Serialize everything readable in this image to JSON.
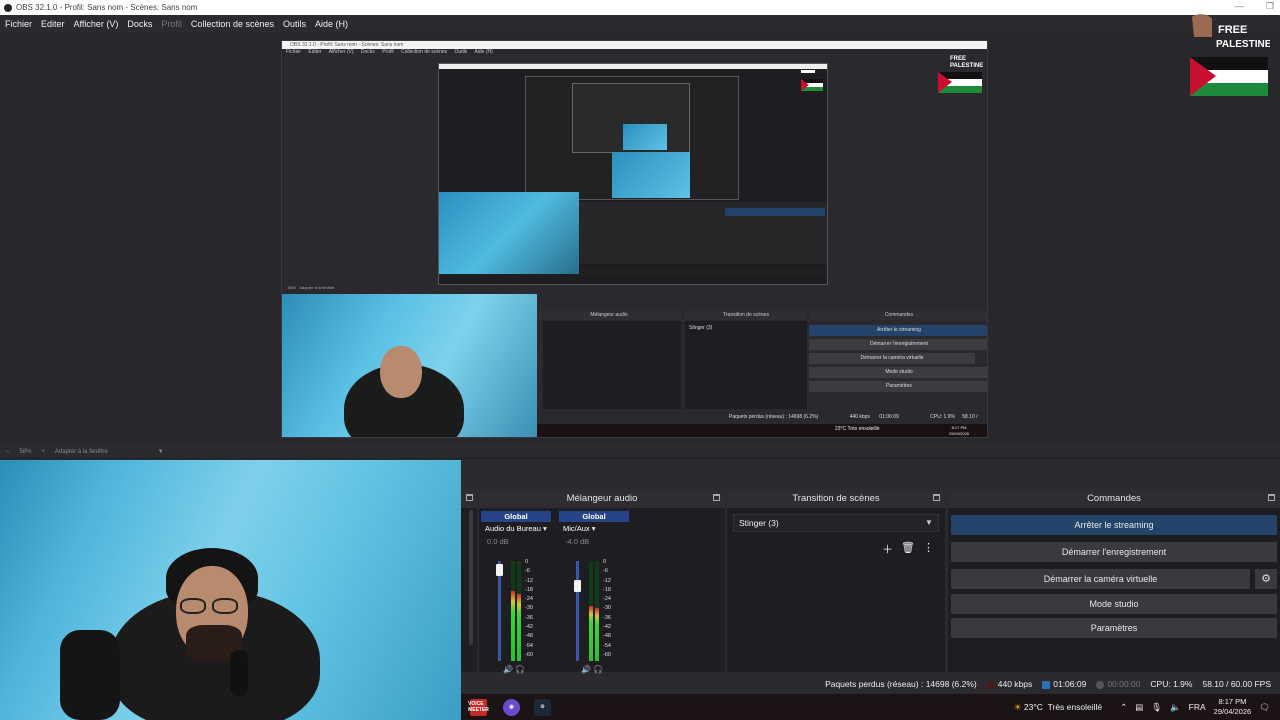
{
  "window": {
    "title": "OBS 32.1.0 - Profil: Sans nom - Scènes: Sans nom"
  },
  "menu": {
    "items": [
      "Fichier",
      "Editer",
      "Afficher (V)",
      "Docks",
      "Profil",
      "Collection de scènes",
      "Outils",
      "Aide (H)"
    ],
    "disabled": [
      "Profil"
    ]
  },
  "overlay": {
    "line1": "FREE",
    "line2": "PALESTINE"
  },
  "zoom": {
    "minus": "−",
    "value": "58%",
    "plus": "+",
    "fit": "Adapter à la fenêtre"
  },
  "mixer": {
    "title": "Mélangeur audio",
    "channels": [
      {
        "badge": "Global",
        "name": "Audio du Bureau",
        "db": "0.0 dB",
        "fader_level": 0.97,
        "meter_level": 0.7
      },
      {
        "badge": "Global",
        "name": "Mic/Aux",
        "db": "-4.0 dB",
        "fader_level": 0.78,
        "meter_level": 0.55
      }
    ],
    "ticks": [
      "0",
      "-6",
      "-12",
      "-18",
      "-24",
      "-30",
      "-36",
      "-42",
      "-48",
      "-54",
      "-60"
    ]
  },
  "transitions": {
    "title": "Transition de scènes",
    "selected": "Stinger (3)"
  },
  "commands": {
    "title": "Commandes",
    "buttons": {
      "stream": "Arrêter le streaming",
      "record": "Démarrer l'enregistrement",
      "vcam": "Démarrer la caméra virtuelle",
      "studio": "Mode studio",
      "settings": "Paramètres"
    }
  },
  "status": {
    "dropped": "Paquets perdus (réseau) : 14698 (6.2%)",
    "bitrate": "440 kbps",
    "stream_time": "01:06:09",
    "rec_time": "00:00:00",
    "cpu": "CPU: 1.9%",
    "fps": "58.10 / 60.00 FPS"
  },
  "taskbar": {
    "voicemeeter_label": "VOICE MEETER",
    "weather_temp": "23°C",
    "weather_desc": "Très ensoleillé",
    "lang": "FRA",
    "time": "8:17 PM",
    "date": "29/04/2026"
  },
  "nested": {
    "commands": [
      "Arrêter le streaming",
      "Démarrer l'enregistrement",
      "Démarrer la caméra virtuelle",
      "Mode studio",
      "Paramètres"
    ]
  },
  "colors": {
    "accent": "#23436a",
    "badge": "#26448a",
    "meter_green": "#3ad43a",
    "flag_green": "#1f8a3a",
    "flag_red": "#c8102e"
  }
}
